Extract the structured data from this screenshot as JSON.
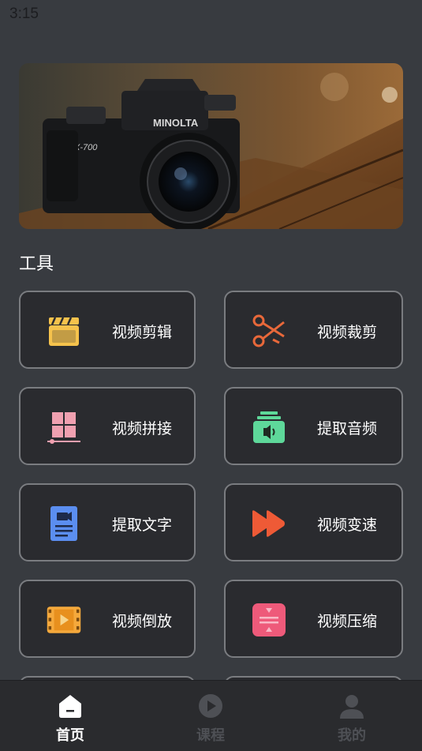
{
  "status_bar": {
    "time": "3:15"
  },
  "banner": {
    "image": "vintage-camera-photo",
    "camera_brand": "MINOLTA",
    "camera_model": "X-700"
  },
  "tools": {
    "section_title": "工具",
    "items": [
      {
        "label": "视频剪辑",
        "icon": "clapperboard-icon",
        "color": "#f5c24c"
      },
      {
        "label": "视频裁剪",
        "icon": "scissors-icon",
        "color": "#e8683a"
      },
      {
        "label": "视频拼接",
        "icon": "grid-merge-icon",
        "color": "#f0a0b0"
      },
      {
        "label": "提取音频",
        "icon": "audio-extract-icon",
        "color": "#5ed89a"
      },
      {
        "label": "提取文字",
        "icon": "document-text-icon",
        "color": "#5b8ef0"
      },
      {
        "label": "视频变速",
        "icon": "fast-forward-icon",
        "color": "#ee5a36"
      },
      {
        "label": "视频倒放",
        "icon": "film-play-icon",
        "color": "#f5a93c"
      },
      {
        "label": "视频压缩",
        "icon": "compress-icon",
        "color": "#ee5a7a"
      }
    ]
  },
  "bottom_nav": {
    "items": [
      {
        "label": "首页",
        "icon": "home-icon",
        "active": true
      },
      {
        "label": "课程",
        "icon": "play-circle-icon",
        "active": false
      },
      {
        "label": "我的",
        "icon": "user-icon",
        "active": false
      }
    ]
  },
  "colors": {
    "background": "#383b40",
    "card": "#2a2b2f",
    "card_border": "#7a7c80",
    "nav_bg": "#2a2b2e"
  }
}
